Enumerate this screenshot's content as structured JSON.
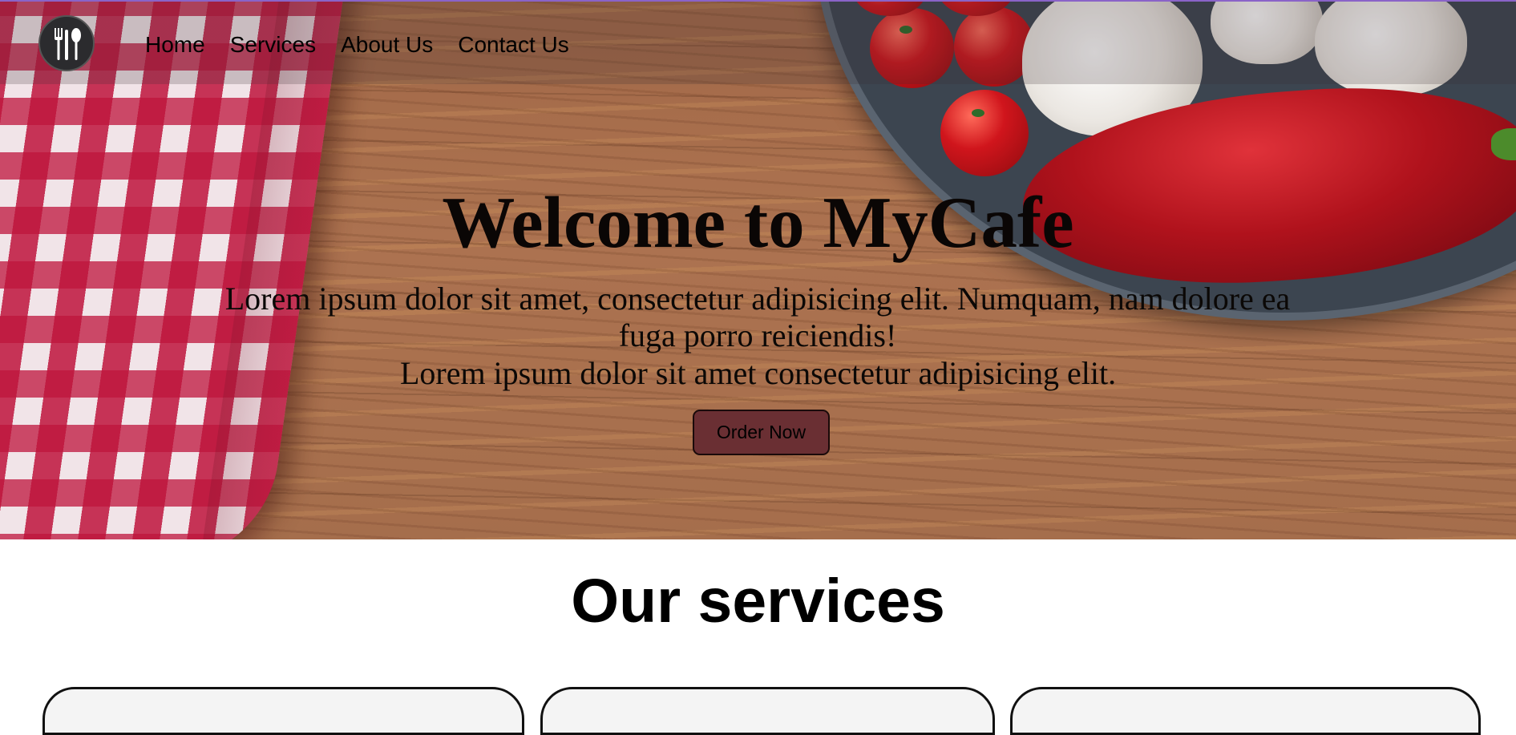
{
  "nav": {
    "logo_icon": "fork-spoon-knife-icon",
    "links": [
      "Home",
      "Services",
      "About Us",
      "Contact Us"
    ]
  },
  "hero": {
    "title": "Welcome to MyCafe",
    "paragraph1": "Lorem ipsum dolor sit amet, consectetur adipisicing elit. Numquam, nam dolore ea fuga porro reiciendis!",
    "paragraph2": "Lorem ipsum dolor sit amet consectetur adipisicing elit.",
    "button_label": "Order Now"
  },
  "services": {
    "title": "Our services",
    "card_count": 3
  },
  "colors": {
    "nav_border": "#8a63c8",
    "button_bg": "#6a2f33"
  }
}
